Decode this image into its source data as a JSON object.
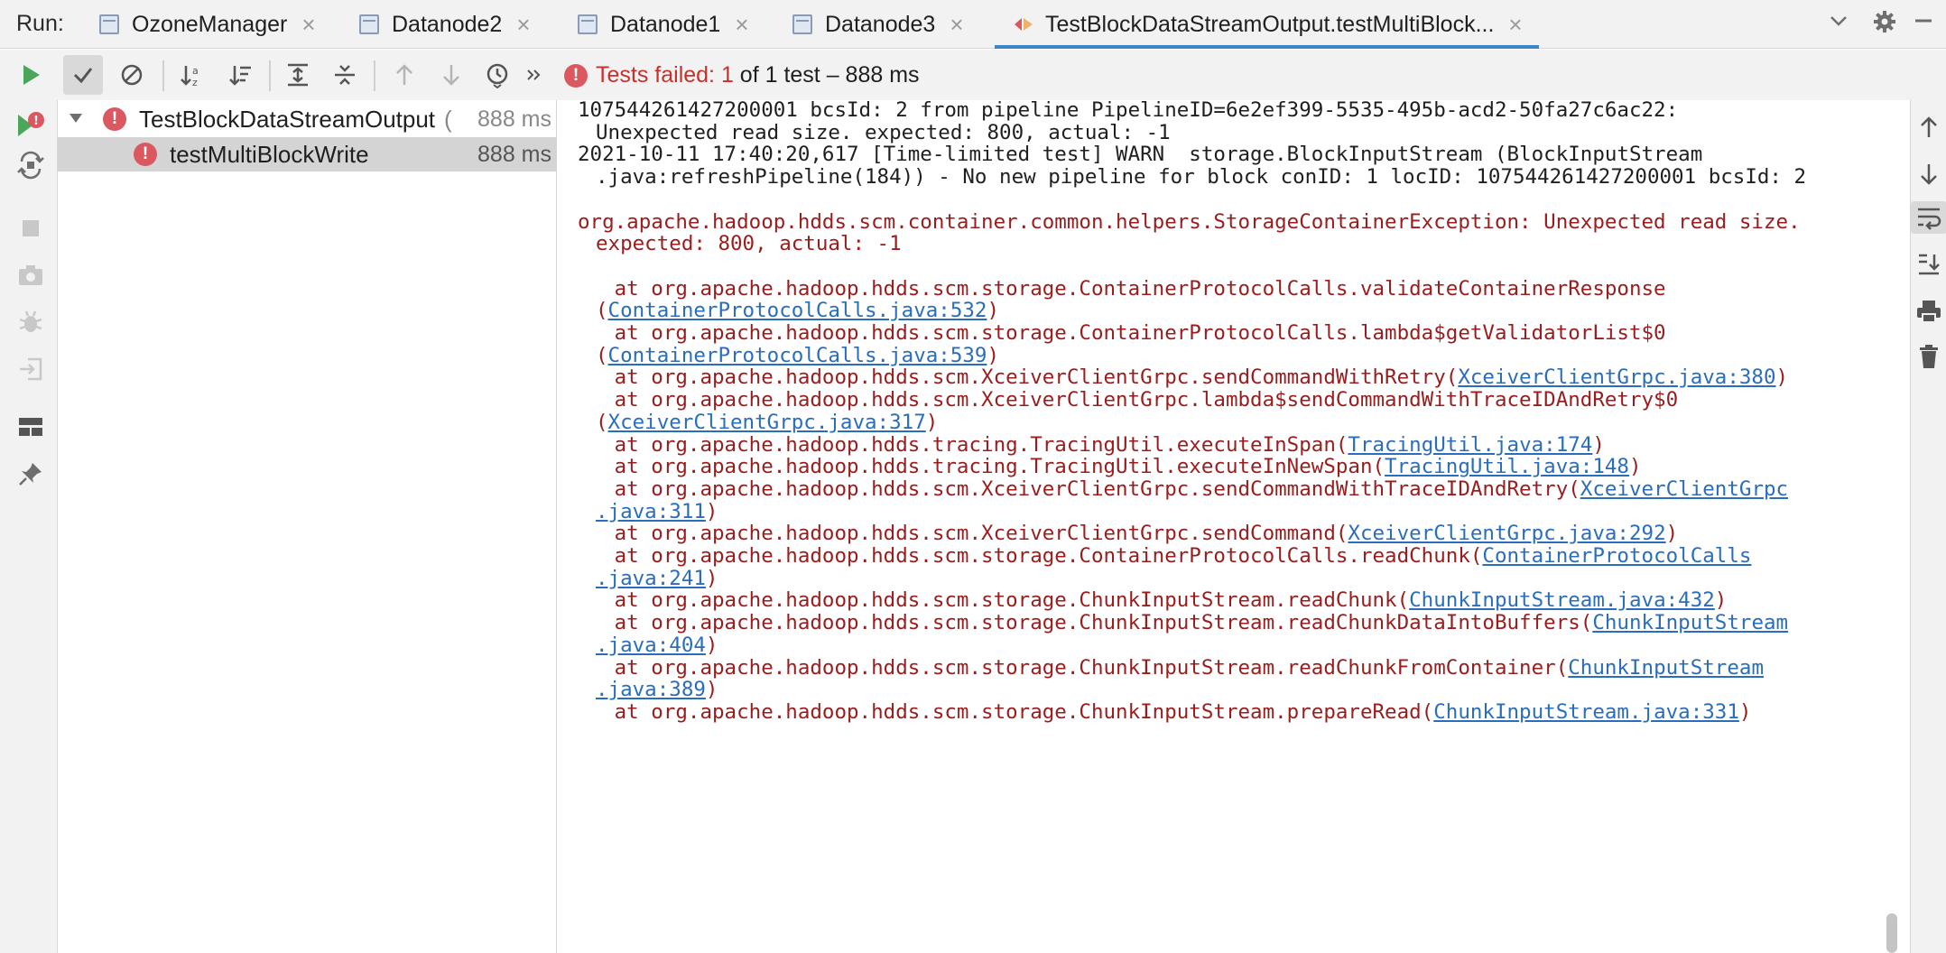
{
  "run_label": "Run:",
  "tabs": [
    {
      "label": "OzoneManager",
      "close": "×"
    },
    {
      "label": "Datanode2",
      "close": "×"
    },
    {
      "label": "Datanode1",
      "close": "×"
    },
    {
      "label": "Datanode3",
      "close": "×"
    },
    {
      "label": "TestBlockDataStreamOutput.testMultiBlock...",
      "close": "×",
      "active": true
    }
  ],
  "status": {
    "failed_text": "Tests failed: 1",
    "rest_text": " of 1 test – 888 ms"
  },
  "tree": {
    "suite": {
      "name": "TestBlockDataStreamOutput",
      "time_prefix": "(",
      "time": "888 ms"
    },
    "test": {
      "name": "testMultiBlockWrite",
      "time": "888 ms"
    }
  },
  "console_lines": [
    {
      "text": "107544261427200001 bcsId: 2 from pipeline PipelineID=6e2ef399-5535-495b-acd2-50fa27c6ac22:",
      "cls": ""
    },
    {
      "text": "Unexpected read size. expected: 800, actual: -1",
      "cls": "ind1"
    },
    {
      "text": "2021-10-11 17:40:20,617 [Time-limited test] WARN  storage.BlockInputStream (BlockInputStream",
      "cls": ""
    },
    {
      "text": ".java:refreshPipeline(184)) - No new pipeline for block conID: 1 locID: 107544261427200001 bcsId: 2",
      "cls": "ind1"
    },
    {
      "text": "",
      "cls": ""
    },
    {
      "text": "org.apache.hadoop.hdds.scm.container.common.helpers.StorageContainerException: Unexpected read size.",
      "cls": "err"
    },
    {
      "text": "expected: 800, actual: -1",
      "cls": "err ind1"
    },
    {
      "text": "",
      "cls": ""
    },
    {
      "pre": "   at org.apache.hadoop.hdds.scm.storage.ContainerProtocolCalls.validateContainerResponse",
      "link": "",
      "post": "",
      "cls": "err"
    },
    {
      "pre": "(",
      "link": "ContainerProtocolCalls.java:532",
      "post": ")",
      "cls": "err ind1"
    },
    {
      "pre": "   at org.apache.hadoop.hdds.scm.storage.ContainerProtocolCalls.lambda$getValidatorList$0",
      "link": "",
      "post": "",
      "cls": "err"
    },
    {
      "pre": "(",
      "link": "ContainerProtocolCalls.java:539",
      "post": ")",
      "cls": "err ind1"
    },
    {
      "pre": "   at org.apache.hadoop.hdds.scm.XceiverClientGrpc.sendCommandWithRetry(",
      "link": "XceiverClientGrpc.java:380",
      "post": ")",
      "cls": "err"
    },
    {
      "pre": "   at org.apache.hadoop.hdds.scm.XceiverClientGrpc.lambda$sendCommandWithTraceIDAndRetry$0",
      "link": "",
      "post": "",
      "cls": "err"
    },
    {
      "pre": "(",
      "link": "XceiverClientGrpc.java:317",
      "post": ")",
      "cls": "err ind1"
    },
    {
      "pre": "   at org.apache.hadoop.hdds.tracing.TracingUtil.executeInSpan(",
      "link": "TracingUtil.java:174",
      "post": ")",
      "cls": "err"
    },
    {
      "pre": "   at org.apache.hadoop.hdds.tracing.TracingUtil.executeInNewSpan(",
      "link": "TracingUtil.java:148",
      "post": ")",
      "cls": "err"
    },
    {
      "pre": "   at org.apache.hadoop.hdds.scm.XceiverClientGrpc.sendCommandWithTraceIDAndRetry(",
      "link": "XceiverClientGrpc",
      "post": "",
      "cls": "err"
    },
    {
      "pre": "",
      "link": ".java:311",
      "post": ")",
      "cls": "err ind1"
    },
    {
      "pre": "   at org.apache.hadoop.hdds.scm.XceiverClientGrpc.sendCommand(",
      "link": "XceiverClientGrpc.java:292",
      "post": ")",
      "cls": "err"
    },
    {
      "pre": "   at org.apache.hadoop.hdds.scm.storage.ContainerProtocolCalls.readChunk(",
      "link": "ContainerProtocolCalls",
      "post": "",
      "cls": "err"
    },
    {
      "pre": "",
      "link": ".java:241",
      "post": ")",
      "cls": "err ind1"
    },
    {
      "pre": "   at org.apache.hadoop.hdds.scm.storage.ChunkInputStream.readChunk(",
      "link": "ChunkInputStream.java:432",
      "post": ")",
      "cls": "err"
    },
    {
      "pre": "   at org.apache.hadoop.hdds.scm.storage.ChunkInputStream.readChunkDataIntoBuffers(",
      "link": "ChunkInputStream",
      "post": "",
      "cls": "err"
    },
    {
      "pre": "",
      "link": ".java:404",
      "post": ")",
      "cls": "err ind1"
    },
    {
      "pre": "   at org.apache.hadoop.hdds.scm.storage.ChunkInputStream.readChunkFromContainer(",
      "link": "ChunkInputStream",
      "post": "",
      "cls": "err"
    },
    {
      "pre": "",
      "link": ".java:389",
      "post": ")",
      "cls": "err ind1"
    },
    {
      "pre": "   at org.apache.hadoop.hdds.scm.storage.ChunkInputStream.prepareRead(",
      "link": "ChunkInputStream.java:331",
      "post": ")",
      "cls": "err"
    }
  ],
  "colors": {
    "error_text": "#9b1c1c",
    "link": "#2a6dbd",
    "accent": "#4083c9",
    "fail_icon": "#db5860",
    "run_green": "#4ca65a"
  },
  "icons": {
    "toolbar": [
      "run-icon",
      "show-passed-icon",
      "show-ignored-icon",
      "sort-alpha-icon",
      "sort-duration-icon",
      "expand-all-icon",
      "collapse-all-icon",
      "prev-failed-icon",
      "next-failed-icon",
      "history-icon",
      "more-icon"
    ],
    "left": [
      "rerun-failed-icon",
      "toggle-autotest-icon",
      "stop-icon",
      "screenshot-icon",
      "debug-icon",
      "exit-icon",
      "layout-icon",
      "pin-icon"
    ],
    "right": [
      "scroll-up-icon",
      "scroll-down-icon",
      "soft-wrap-icon",
      "scroll-to-end-icon",
      "print-icon",
      "clear-icon"
    ]
  }
}
